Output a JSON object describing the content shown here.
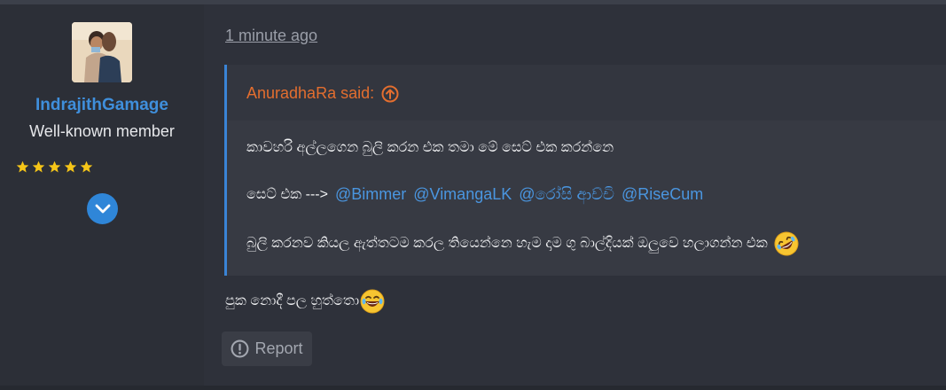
{
  "author": {
    "username": "IndrajithGamage",
    "title": "Well-known member",
    "stars": 5
  },
  "post": {
    "timestamp": "1 minute ago",
    "quote": {
      "author_label": "AnuradhaRa said:",
      "line1": "කාවහරි අල්ලගෙන බුලි කරන එක තමා මේ සෙට් එක කරන්නෙ",
      "line2_prefix": "සෙට් එක --->",
      "mentions": [
        "@Bimmer",
        "@VimangaLK",
        "@රෝසි ආච්චි",
        "@RiseCum"
      ],
      "line3": "බුලි කරනව කියල ඇත්තටම කරල තියෙන්නෙ හැම දාම ගු බාල්දියක් ඔලුවෙ හලාගන්න එක"
    },
    "reply_text": "පුක නොදී පල හුත්තො",
    "report_label": "Report"
  },
  "colors": {
    "accent_blue": "#3f8fdc",
    "quote_author_orange": "#e36e2f",
    "star_yellow": "#f5c518"
  },
  "icons": [
    "star-icon",
    "chevron-down-icon",
    "arrow-up-circle-icon",
    "rofl-emoji-icon",
    "laughing-emoji-icon",
    "alert-circle-icon"
  ]
}
